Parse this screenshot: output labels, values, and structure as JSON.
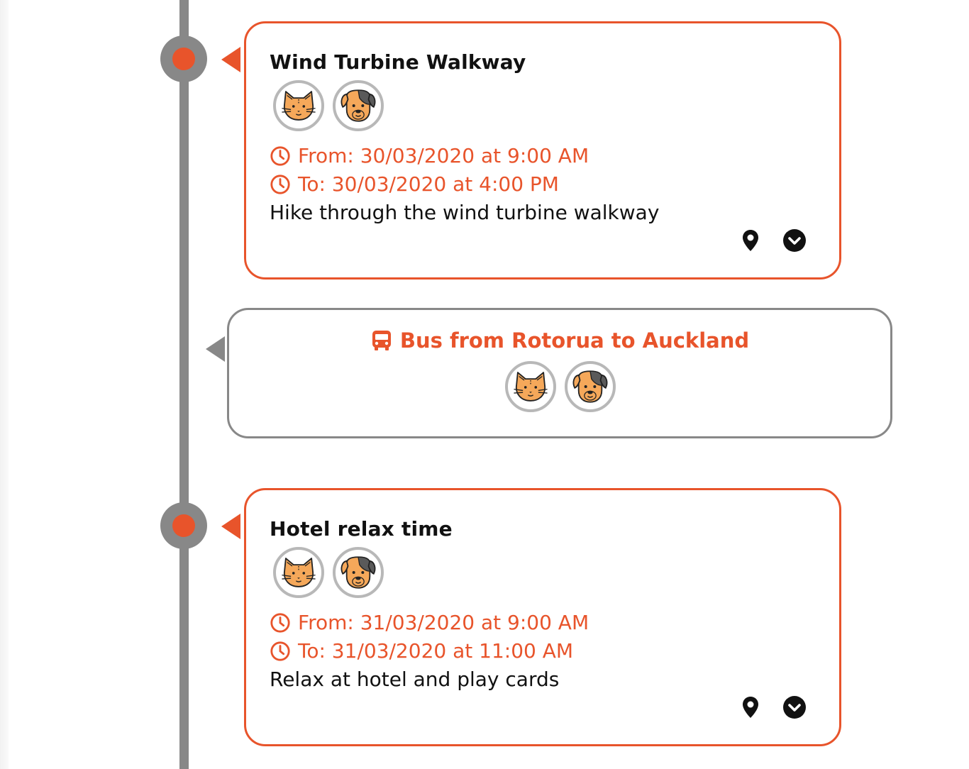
{
  "colors": {
    "accent": "#e8542b",
    "timeline": "#888888",
    "avatar_border": "#b8b8b8",
    "cat_fill": "#f5a85a",
    "dog_patch": "#5a5a5a",
    "text": "#111111"
  },
  "events": [
    {
      "title": "Wind Turbine Walkway",
      "attendees": [
        "cat-icon",
        "dog-icon"
      ],
      "from": "From: 30/03/2020 at 9:00 AM",
      "to": "To: 30/03/2020 at 4:00 PM",
      "description": "Hike through the wind turbine walkway",
      "actions": [
        "map-pin-icon",
        "chevron-down-circle-icon"
      ]
    },
    {
      "title": "Hotel relax time",
      "attendees": [
        "cat-icon",
        "dog-icon"
      ],
      "from": "From: 31/03/2020 at 9:00 AM",
      "to": "To: 31/03/2020 at 11:00 AM",
      "description": "Relax at hotel and play cards",
      "actions": [
        "map-pin-icon",
        "chevron-down-circle-icon"
      ]
    }
  ],
  "transport": {
    "icon": "bus-icon",
    "title": "Bus from Rotorua to Auckland",
    "attendees": [
      "cat-icon",
      "dog-icon"
    ]
  }
}
